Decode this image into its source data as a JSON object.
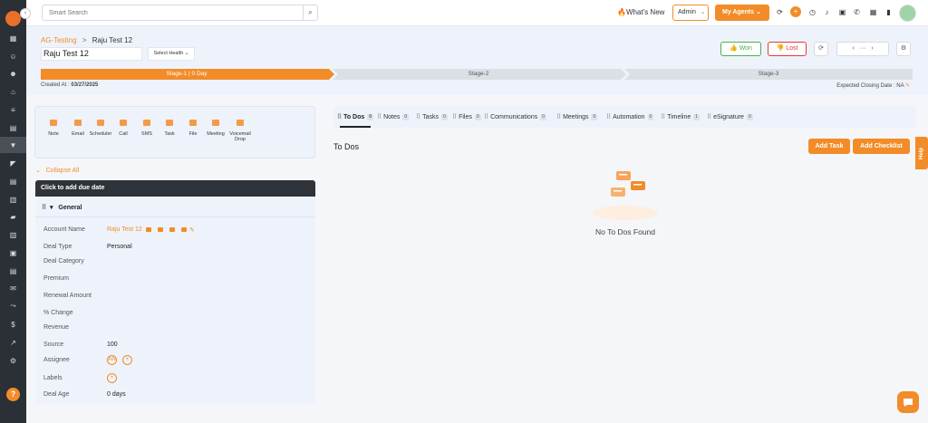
{
  "sidebar": {
    "items": [
      "dashboard-icon",
      "contacts-icon",
      "people-icon",
      "bank-icon",
      "list-icon",
      "book-icon",
      "funnel-icon",
      "megaphone-icon",
      "document-icon",
      "chart-icon",
      "folder-icon",
      "building-icon",
      "calendar-icon",
      "inbox-icon",
      "mail-icon",
      "routing-icon",
      "dollar-icon",
      "trend-icon",
      "settings-icon"
    ],
    "active_index": 6,
    "help_label": "?"
  },
  "topbar": {
    "search_placeholder": "Smart Search",
    "whats_new": "What's New",
    "admin": "Admin",
    "my_agents": "My Agents"
  },
  "header": {
    "breadcrumb_parent": "AG-Testing",
    "breadcrumb_sep": ">",
    "breadcrumb_current": "Raju Test 12",
    "deal_name": "Raju Test 12",
    "select_health": "Select Health",
    "won": "Won",
    "lost": "Lost",
    "stages": [
      "Stage-1 | 0 Day",
      "Stage-2",
      "Stage-3"
    ],
    "created_at_label": "Created At :",
    "created_at_value": "03/27/2025",
    "expected_closing": "Expected Closing Date : NA"
  },
  "actions": [
    "Note",
    "Email",
    "Scheduler",
    "Call",
    "SMS",
    "Task",
    "File",
    "Meeting",
    "Voicemail Drop"
  ],
  "collapse_all": "Collapse All",
  "due_date": "Click to add due date",
  "general": {
    "title": "General",
    "fields": [
      {
        "label": "Account Name",
        "value": "Raju Test 12"
      },
      {
        "label": "Deal Type",
        "value": "Personal"
      },
      {
        "label": "Deal Category",
        "value": ""
      },
      {
        "label": "Premium",
        "value": ""
      },
      {
        "label": "Renewal Amount",
        "value": ""
      },
      {
        "label": "% Change",
        "value": ""
      },
      {
        "label": "Revenue",
        "value": ""
      },
      {
        "label": "Source",
        "value": "100"
      },
      {
        "label": "Assignee",
        "value": "AN"
      },
      {
        "label": "Labels",
        "value": ""
      },
      {
        "label": "Deal Age",
        "value": "0 days"
      }
    ]
  },
  "tabs": [
    {
      "label": "To Dos",
      "count": "0"
    },
    {
      "label": "Notes",
      "count": "0"
    },
    {
      "label": "Tasks",
      "count": "0"
    },
    {
      "label": "Files",
      "count": "0"
    },
    {
      "label": "Communications",
      "count": "0"
    },
    {
      "label": "Meetings",
      "count": "0"
    },
    {
      "label": "Automation",
      "count": "0"
    },
    {
      "label": "Timeline",
      "count": "1"
    },
    {
      "label": "eSignature",
      "count": "0"
    }
  ],
  "todos": {
    "title": "To Dos",
    "add_task": "Add Task",
    "add_checklist": "Add Checklist",
    "empty": "No To Dos Found"
  },
  "help_tab": "Help",
  "colors": {
    "accent": "#f28c28",
    "sidebar": "#2b2f36",
    "won": "#4caf50",
    "lost": "#e53935"
  }
}
